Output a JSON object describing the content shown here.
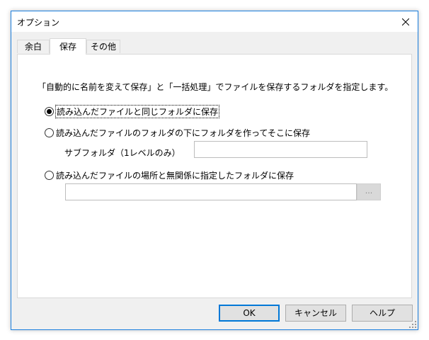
{
  "window": {
    "title": "オプション"
  },
  "tabs": [
    {
      "label": "余白",
      "active": false
    },
    {
      "label": "保存",
      "active": true
    },
    {
      "label": "その他",
      "active": false
    }
  ],
  "panel": {
    "instruction": "「自動的に名前を変えて保存」と「一括処理」でファイルを保存するフォルダを指定します。",
    "options": [
      {
        "label": "読み込んだファイルと同じフォルダに保存",
        "checked": true
      },
      {
        "label": "読み込んだファイルのフォルダの下にフォルダを作ってそこに保存",
        "checked": false
      },
      {
        "label": "読み込んだファイルの場所と無関係に指定したフォルダに保存",
        "checked": false
      }
    ],
    "subfolder_label": "サブフォルダ（1レベルのみ）",
    "subfolder_value": "",
    "folder_path_value": "",
    "browse_label": "..."
  },
  "buttons": {
    "ok": "OK",
    "cancel": "キャンセル",
    "help": "ヘルプ"
  },
  "colors": {
    "accent": "#0078d7",
    "window_border": "#1c7fdf"
  },
  "icons": {
    "close": "close-icon",
    "resize": "resize-grip-icon"
  }
}
